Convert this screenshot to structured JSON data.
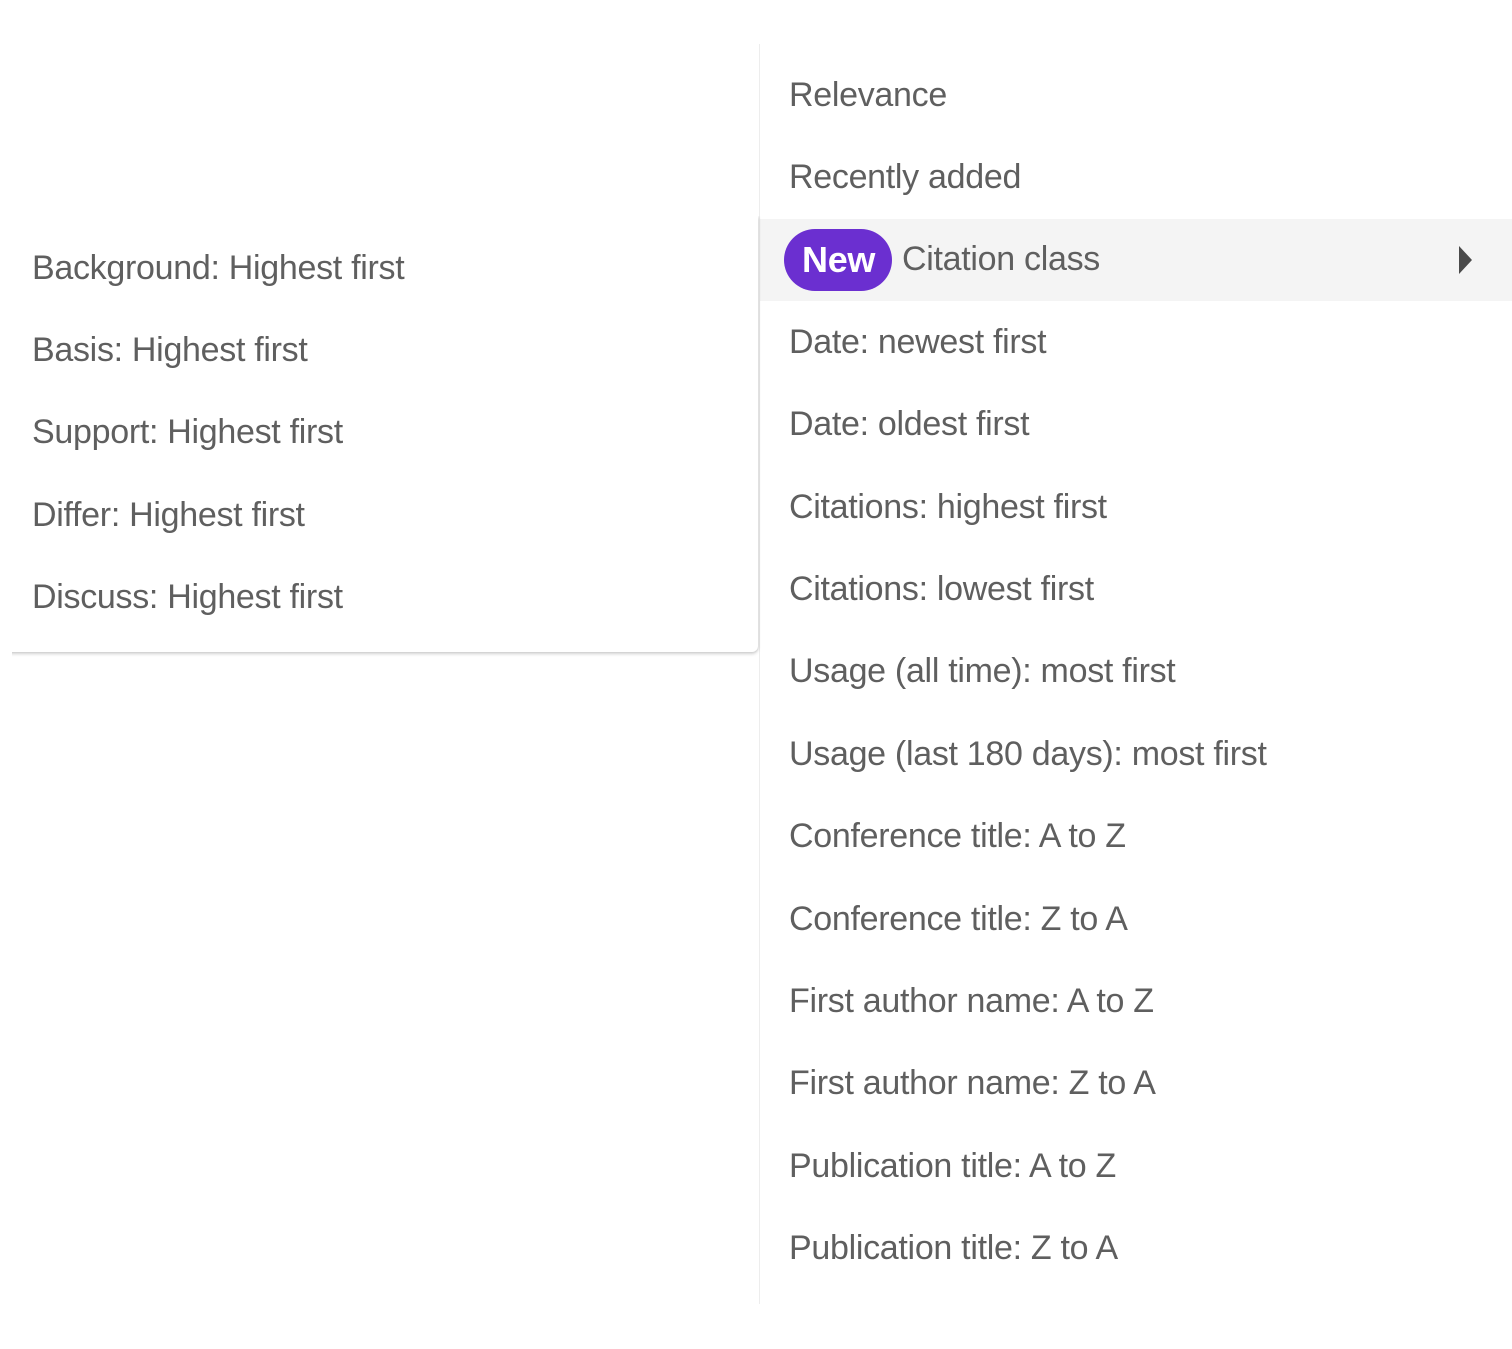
{
  "sort_menu": {
    "items": [
      {
        "label": "Relevance"
      },
      {
        "label": "Recently added"
      },
      {
        "label": "Citation class",
        "badge": "New",
        "has_submenu": true,
        "active": true
      },
      {
        "label": "Date: newest first"
      },
      {
        "label": "Date: oldest first"
      },
      {
        "label": "Citations: highest first"
      },
      {
        "label": "Citations: lowest first"
      },
      {
        "label": "Usage (all time): most first"
      },
      {
        "label": "Usage (last 180 days): most first"
      },
      {
        "label": "Conference title: A to Z"
      },
      {
        "label": "Conference title: Z to A"
      },
      {
        "label": "First author name: A to Z"
      },
      {
        "label": "First author name: Z to A"
      },
      {
        "label": "Publication title: A to Z"
      },
      {
        "label": "Publication title: Z to A"
      }
    ]
  },
  "citation_submenu": {
    "items": [
      {
        "label": "Background: Highest first"
      },
      {
        "label": "Basis: Highest first"
      },
      {
        "label": "Support: Highest first"
      },
      {
        "label": "Differ: Highest first"
      },
      {
        "label": "Discuss: Highest first"
      }
    ]
  },
  "colors": {
    "badge_background": "#6b2fd0",
    "text": "#5f5f5f",
    "active_row": "#f4f4f4"
  },
  "icons": {
    "submenu_arrow": "caret-right-icon"
  }
}
